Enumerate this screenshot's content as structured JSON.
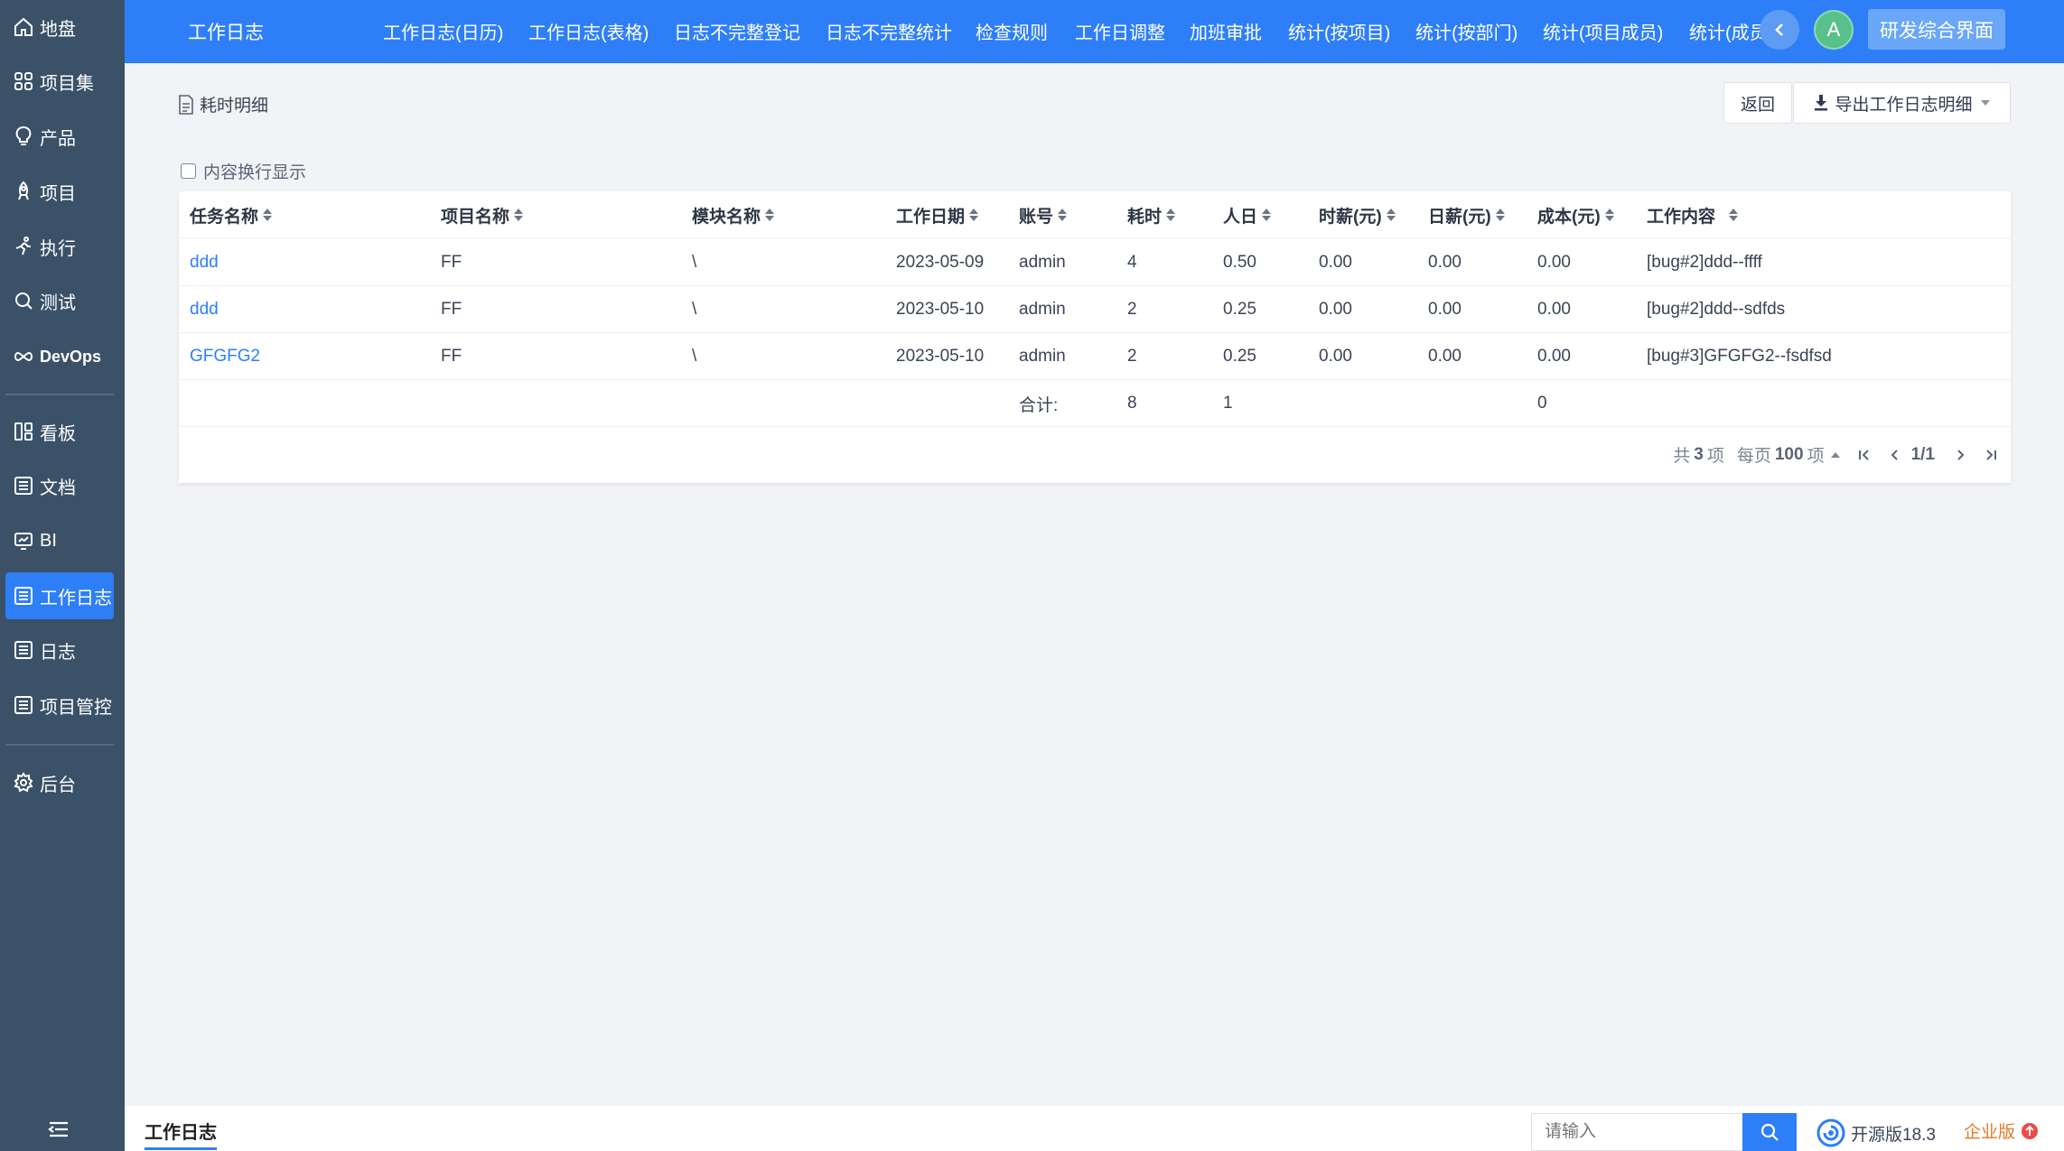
{
  "colors": {
    "primary": "#2e7ff7",
    "sidebar": "#3a5168",
    "link": "#2e7ff7",
    "accent_orange": "#e07b28"
  },
  "sidebar": {
    "items": [
      {
        "label": "地盘",
        "icon": "home-icon"
      },
      {
        "label": "项目集",
        "icon": "grid-icon"
      },
      {
        "label": "产品",
        "icon": "bulb-icon"
      },
      {
        "label": "项目",
        "icon": "project-icon"
      },
      {
        "label": "执行",
        "icon": "run-icon"
      },
      {
        "label": "测试",
        "icon": "magnifier-icon"
      },
      {
        "label": "DevOps",
        "icon": "infinity-icon"
      },
      {
        "label": "看板",
        "icon": "kanban-icon"
      },
      {
        "label": "文档",
        "icon": "doc-icon"
      },
      {
        "label": "BI",
        "icon": "monitor-icon"
      },
      {
        "label": "工作日志",
        "icon": "list-icon"
      },
      {
        "label": "日志",
        "icon": "list-icon"
      },
      {
        "label": "项目管控",
        "icon": "list-icon"
      },
      {
        "label": "后台",
        "icon": "gear-icon"
      }
    ],
    "active": "工作日志"
  },
  "header": {
    "title": "工作日志",
    "tabs": [
      "工作日志(日历)",
      "工作日志(表格)",
      "日志不完整登记",
      "日志不完整统计",
      "检查规则",
      "工作日调整",
      "加班审批",
      "统计(按项目)",
      "统计(按部门)",
      "统计(项目成员)",
      "统计(成员"
    ],
    "avatar_letter": "A",
    "rd_button": "研发综合界面"
  },
  "toolbar": {
    "crumb": "耗时明细",
    "back": "返回",
    "export": "导出工作日志明细",
    "wrap_label": "内容换行显示"
  },
  "table": {
    "columns": [
      "任务名称",
      "项目名称",
      "模块名称",
      "工作日期",
      "账号",
      "耗时",
      "人日",
      "时薪(元)",
      "日薪(元)",
      "成本(元)",
      "工作内容"
    ],
    "rows": [
      [
        "ddd",
        "FF",
        "\\",
        "2023-05-09",
        "admin",
        "4",
        "0.50",
        "0.00",
        "0.00",
        "0.00",
        "[bug#2]ddd--ffff"
      ],
      [
        "ddd",
        "FF",
        "\\",
        "2023-05-10",
        "admin",
        "2",
        "0.25",
        "0.00",
        "0.00",
        "0.00",
        "[bug#2]ddd--sdfds"
      ],
      [
        "GFGFG2",
        "FF",
        "\\",
        "2023-05-10",
        "admin",
        "2",
        "0.25",
        "0.00",
        "0.00",
        "0.00",
        "[bug#3]GFGFG2--fsdfsd"
      ]
    ],
    "summary": {
      "label": "合计:",
      "hours": "8",
      "days": "1",
      "cost": "0"
    }
  },
  "pager": {
    "total_prefix": "共",
    "total": "3",
    "total_suffix": "项",
    "per_prefix": "每页",
    "per": "100",
    "per_suffix": "项",
    "page": "1/1"
  },
  "bottom": {
    "tab": "工作日志",
    "search_placeholder": "请输入",
    "version": "开源版18.3",
    "enterprise": "企业版"
  }
}
